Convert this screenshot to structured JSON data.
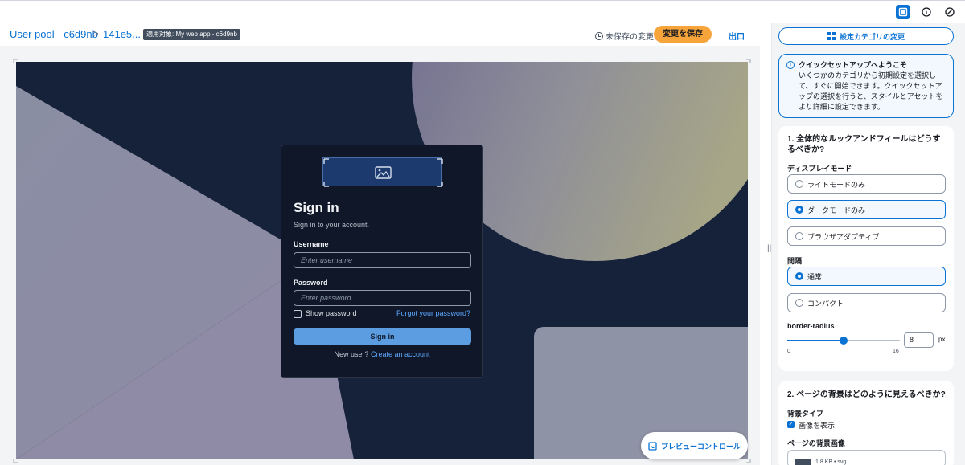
{
  "topbar": {
    "icons": [
      "layout-panel-icon",
      "info-icon",
      "settings-icon"
    ]
  },
  "header": {
    "breadcrumb_pool": "User pool - c6d9nb",
    "breadcrumb_sep": ">",
    "breadcrumb_client": "141e5...",
    "applies_badge": "適用対象: My web app - c6d9nb",
    "unsaved_text": "未保存の変更",
    "save_label": "変更を保存",
    "exit_label": "出口"
  },
  "signin_card": {
    "title": "Sign in",
    "subtitle": "Sign in to your account.",
    "username_label": "Username",
    "username_placeholder": "Enter username",
    "password_label": "Password",
    "password_placeholder": "Enter password",
    "show_password_label": "Show password",
    "forgot_link": "Forgot your password?",
    "submit_label": "Sign in",
    "new_user_text": "New user?",
    "create_account_link": "Create an account"
  },
  "preview_controls_label": "プレビューコントロール",
  "panel": {
    "category_button": "設定カテゴリの変更",
    "info": {
      "title": "クイックセットアップへようこそ",
      "body": "いくつかのカテゴリから初期設定を選択して、すぐに開始できます。クイックセットアップの選択を行うと、スタイルとアセットをより詳細に設定できます。"
    },
    "section1": {
      "heading": "1. 全体的なルックアンドフィールはどうするべきか?",
      "display_mode_label": "ディスプレイモード",
      "display_options": [
        {
          "label": "ライトモードのみ",
          "selected": false
        },
        {
          "label": "ダークモードのみ",
          "selected": true
        },
        {
          "label": "ブラウザアダプティブ",
          "selected": false
        }
      ],
      "spacing_label": "間隔",
      "spacing_options": [
        {
          "label": "通常",
          "selected": true
        },
        {
          "label": "コンパクト",
          "selected": false
        }
      ],
      "border_radius_label": "border-radius",
      "border_radius_value": "8",
      "border_radius_unit": "px",
      "slider_min": "0",
      "slider_max": "16",
      "slider_fraction": 0.5
    },
    "section2": {
      "heading": "2. ページの背景はどのように見えるべきか?",
      "bg_type_label": "背景タイプ",
      "show_image_label": "画像を表示",
      "show_image_checked": true,
      "bg_image_label": "ページの背景画像",
      "file_meta": "1.8 KB • svg"
    }
  },
  "colors": {
    "accent": "#0972d3",
    "save_button": "#f7a43b",
    "preview_dark": "#16213a",
    "card_bg": "#0f1729"
  }
}
